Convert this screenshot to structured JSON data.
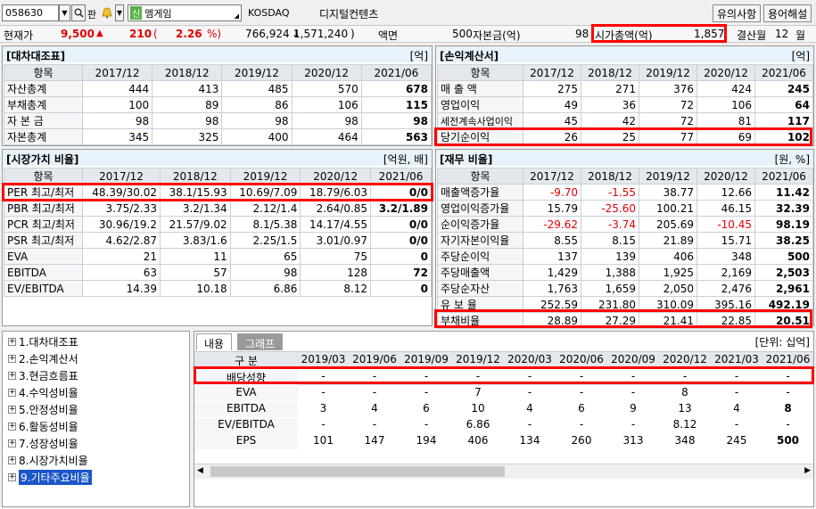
{
  "toolbar": {
    "code": "058630",
    "pan_label": "판",
    "new_badge": "신",
    "company": "엠게임",
    "market": "KOSDAQ",
    "sector": "디지털컨텐츠",
    "notice_button": "유의사항",
    "terms_button": "용어해설"
  },
  "price": {
    "label": "현재가",
    "value": "9,500",
    "arrow": "▲",
    "change": "210",
    "pct": "2.26",
    "volume": "766,924",
    "volume_sep": "1,571,240",
    "par_label": "액면",
    "par_value": "500",
    "capital_label": "자본금(억)",
    "capital_value": "98",
    "mcap_label": "시가총액(억)",
    "mcap_value": "1,857",
    "settle_label": "결산월",
    "settle_value": "12",
    "settle_unit": "월"
  },
  "balance": {
    "title": "[대차대조표]",
    "unit": "[억]",
    "headers": [
      "항목",
      "2017/12",
      "2018/12",
      "2019/12",
      "2020/12",
      "2021/06"
    ],
    "rows": [
      [
        "자산총계",
        "444",
        "413",
        "485",
        "570",
        "678"
      ],
      [
        "부채총계",
        "100",
        "89",
        "86",
        "106",
        "115"
      ],
      [
        "자 본 금",
        "98",
        "98",
        "98",
        "98",
        "98"
      ],
      [
        "자본총계",
        "345",
        "325",
        "400",
        "464",
        "563"
      ]
    ]
  },
  "income": {
    "title": "[손익계산서]",
    "unit": "[억]",
    "headers": [
      "항목",
      "2017/12",
      "2018/12",
      "2019/12",
      "2020/12",
      "2021/06"
    ],
    "rows": [
      [
        "매 출 액",
        "275",
        "271",
        "376",
        "424",
        "245"
      ],
      [
        "영업이익",
        "49",
        "36",
        "72",
        "106",
        "64"
      ],
      [
        "세전계속사업이익",
        "45",
        "42",
        "72",
        "81",
        "117"
      ],
      [
        "당기순이익",
        "26",
        "25",
        "77",
        "69",
        "102"
      ]
    ]
  },
  "market": {
    "title": "[시장가치 비율]",
    "unit": "[억원, 배]",
    "headers": [
      "항목",
      "2017/12",
      "2018/12",
      "2019/12",
      "2020/12",
      "2021/06"
    ],
    "rows": [
      [
        "PER 최고/최저",
        "48.39/30.02",
        "38.1/15.93",
        "10.69/7.09",
        "18.79/6.03",
        "0/0"
      ],
      [
        "PBR 최고/최저",
        "3.75/2.33",
        "3.2/1.34",
        "2.12/1.4",
        "2.64/0.85",
        "3.2/1.89"
      ],
      [
        "PCR 최고/최저",
        "30.96/19.2",
        "21.57/9.02",
        "8.1/5.38",
        "14.17/4.55",
        "0/0"
      ],
      [
        "PSR 최고/최저",
        "4.62/2.87",
        "3.83/1.6",
        "2.25/1.5",
        "3.01/0.97",
        "0/0"
      ],
      [
        "EVA",
        "21",
        "11",
        "65",
        "75",
        "0"
      ],
      [
        "EBITDA",
        "63",
        "57",
        "98",
        "128",
        "72"
      ],
      [
        "EV/EBITDA",
        "14.39",
        "10.18",
        "6.86",
        "8.12",
        "0"
      ]
    ]
  },
  "finance": {
    "title": "[재무 비율]",
    "unit": "[원, %]",
    "headers": [
      "항목",
      "2017/12",
      "2018/12",
      "2019/12",
      "2020/12",
      "2021/06"
    ],
    "rows": [
      [
        "매출액증가율",
        "-9.70",
        "-1.55",
        "38.77",
        "12.66",
        "11.42"
      ],
      [
        "영업이익증가율",
        "15.79",
        "-25.60",
        "100.21",
        "46.15",
        "32.39"
      ],
      [
        "순이익증가율",
        "-29.62",
        "-3.74",
        "205.69",
        "-10.45",
        "98.19"
      ],
      [
        "자기자본이익율",
        "8.55",
        "8.15",
        "21.89",
        "15.71",
        "38.25"
      ],
      [
        "주당순이익",
        "137",
        "139",
        "406",
        "348",
        "500"
      ],
      [
        "주당매출액",
        "1,429",
        "1,388",
        "1,925",
        "2,169",
        "2,503"
      ],
      [
        "주당순자산",
        "1,763",
        "1,659",
        "2,050",
        "2,476",
        "2,961"
      ],
      [
        "유 보 율",
        "252.59",
        "231.80",
        "310.09",
        "395.16",
        "492.19"
      ],
      [
        "부채비율",
        "28.89",
        "27.29",
        "21.41",
        "22.85",
        "20.51"
      ]
    ]
  },
  "tree": {
    "items": [
      "1.대차대조표",
      "2.손익계산서",
      "3.현금흐름표",
      "4.수익성비율",
      "5.안정성비율",
      "6.활동성비율",
      "7.성장성비율",
      "8.시장가치비율",
      "9.기타주요비율"
    ]
  },
  "bottom": {
    "tab_content": "내용",
    "tab_graph": "그래프",
    "unit": "[단위: 십억]",
    "headers": [
      "구 분",
      "2019/03",
      "2019/06",
      "2019/09",
      "2019/12",
      "2020/03",
      "2020/06",
      "2020/09",
      "2020/12",
      "2021/03",
      "2021/06"
    ],
    "rows": [
      [
        "배당성향",
        "-",
        "-",
        "-",
        "-",
        "-",
        "-",
        "-",
        "-",
        "-",
        "-"
      ],
      [
        "EVA",
        "-",
        "-",
        "-",
        "7",
        "-",
        "-",
        "-",
        "8",
        "-",
        "-"
      ],
      [
        "EBITDA",
        "3",
        "4",
        "6",
        "10",
        "4",
        "6",
        "9",
        "13",
        "4",
        "8"
      ],
      [
        "EV/EBITDA",
        "-",
        "-",
        "-",
        "6.86",
        "-",
        "-",
        "-",
        "8.12",
        "-",
        "-"
      ],
      [
        "EPS",
        "101",
        "147",
        "194",
        "406",
        "134",
        "260",
        "313",
        "348",
        "245",
        "500"
      ]
    ]
  }
}
